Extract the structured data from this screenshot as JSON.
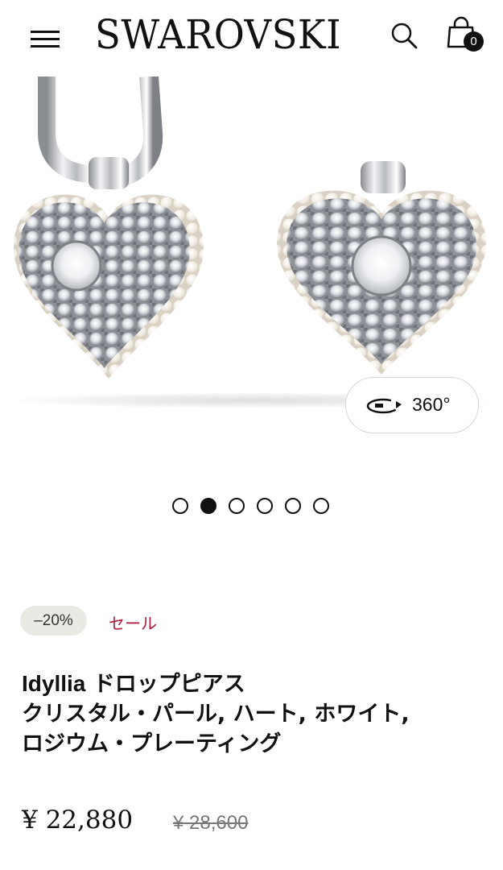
{
  "header": {
    "logo": "SWAROVSKI",
    "cart_count": "0",
    "icons": {
      "menu": "hamburger-menu-icon",
      "search": "search-icon",
      "cart": "shopping-bag-icon"
    }
  },
  "gallery": {
    "view_360_label": "360°",
    "view_360_icon": "rotate-360-icon",
    "slide_count": 6,
    "active_slide": 2
  },
  "product": {
    "discount": "–20%",
    "sale_label": "セール",
    "title_brand": "Idyllia",
    "title_line1": " ドロップピアス",
    "title_line2": "クリスタル・パール, ハート, ホワイト,",
    "title_line3": "ロジウム・プレーティング",
    "price": "¥ 22,880",
    "original_price": "¥ 28,600"
  },
  "colors": {
    "sale_red": "#b0193a",
    "badge_bg": "#ebe9e4",
    "text": "#111111"
  }
}
